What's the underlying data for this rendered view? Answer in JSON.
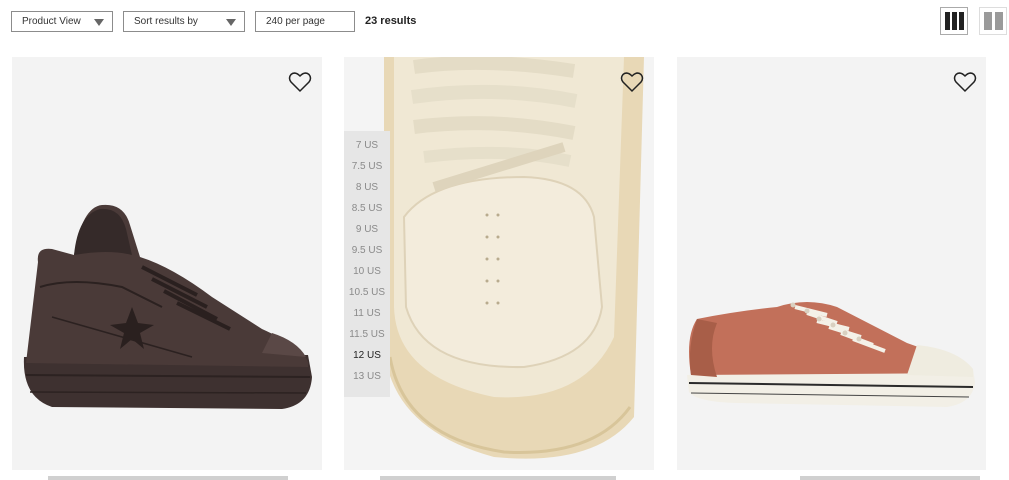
{
  "toolbar": {
    "product_view": "Product View",
    "sort": "Sort results by",
    "per_page": "240 per page",
    "results": "23 results"
  },
  "sizes": [
    "7 US",
    "7.5 US",
    "8 US",
    "8.5 US",
    "9 US",
    "9.5 US",
    "10 US",
    "10.5 US",
    "11 US",
    "11.5 US",
    "12 US",
    "13 US"
  ],
  "selected_size": "12 US",
  "colors": {
    "card_bg": "#f4f4f4",
    "sneaker_dark": "#3a2c2a",
    "sneaker_cream": "#efe6d2",
    "sneaker_rust": "#c06b4c",
    "accent_text": "#222222"
  },
  "icons": [
    "chevron-down-icon",
    "grid-three-columns-icon",
    "grid-two-columns-icon",
    "heart-icon"
  ]
}
